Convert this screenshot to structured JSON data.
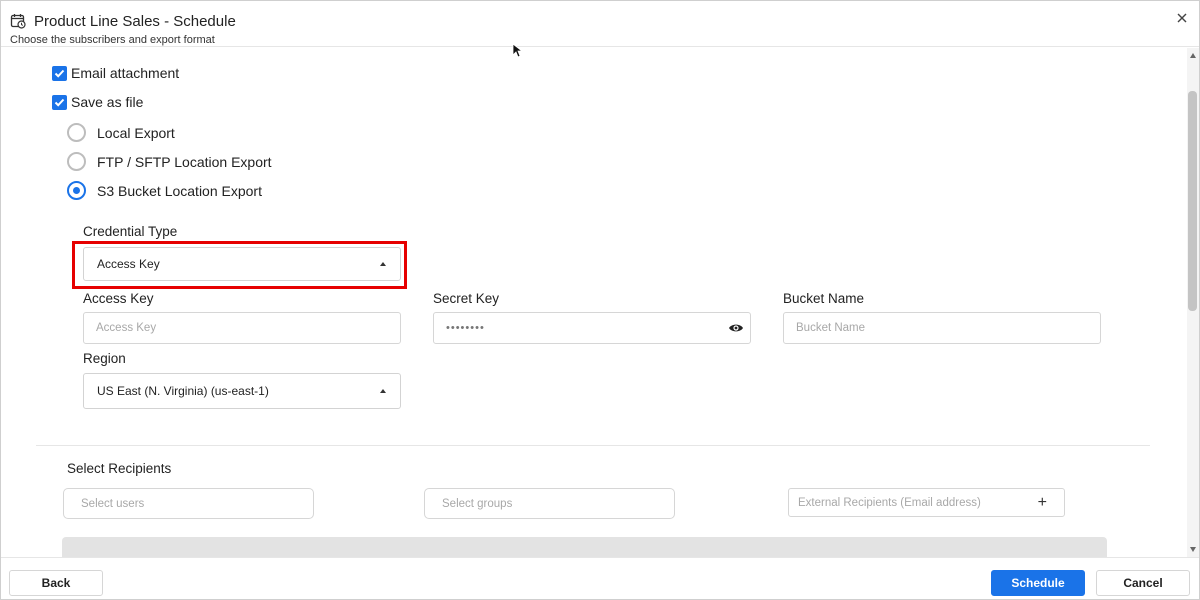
{
  "header": {
    "title": "Product Line Sales - Schedule",
    "subtitle": "Choose the subscribers and export format"
  },
  "options": {
    "email_attachment": {
      "label": "Email attachment",
      "checked": true
    },
    "save_as_file": {
      "label": "Save as file",
      "checked": true
    }
  },
  "export_types": [
    {
      "label": "Local Export",
      "selected": false
    },
    {
      "label": "FTP / SFTP Location Export",
      "selected": false
    },
    {
      "label": "S3 Bucket Location Export",
      "selected": true
    }
  ],
  "s3": {
    "credential_type_label": "Credential Type",
    "credential_type_value": "Access Key",
    "access_key_label": "Access Key",
    "access_key_placeholder": "Access Key",
    "secret_key_label": "Secret Key",
    "secret_key_value": "••••••••",
    "bucket_name_label": "Bucket Name",
    "bucket_name_placeholder": "Bucket Name",
    "region_label": "Region",
    "region_value": "US East (N. Virginia) (us-east-1)"
  },
  "recipients": {
    "title": "Select Recipients",
    "users_placeholder": "Select users",
    "groups_placeholder": "Select groups",
    "external_placeholder": "External Recipients (Email address)",
    "add_symbol": "+"
  },
  "footer": {
    "back_label": "Back",
    "schedule_label": "Schedule",
    "cancel_label": "Cancel"
  },
  "colors": {
    "accent": "#1a73e8",
    "highlight": "#e60000"
  }
}
